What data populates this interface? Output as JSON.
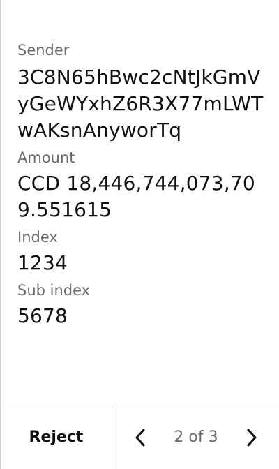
{
  "fields": {
    "sender_label": "Sender",
    "sender_value": "3C8N65hBwc2cNtJkGmVyGeWYxhZ6R3X77mLWTwAKsnAnyworTq",
    "amount_label": "Amount",
    "amount_value": "CCD 18,446,744,073,709.551615",
    "index_label": "Index",
    "index_value": "1234",
    "subindex_label": "Sub index",
    "subindex_value": "5678"
  },
  "footer": {
    "reject_label": "Reject",
    "page_indicator": "2 of 3",
    "prev_icon": "chevron-left-icon",
    "next_icon": "chevron-right-icon"
  },
  "colors": {
    "label": "#6b6b6b",
    "value": "#111111",
    "divider": "#cfcfcf"
  }
}
